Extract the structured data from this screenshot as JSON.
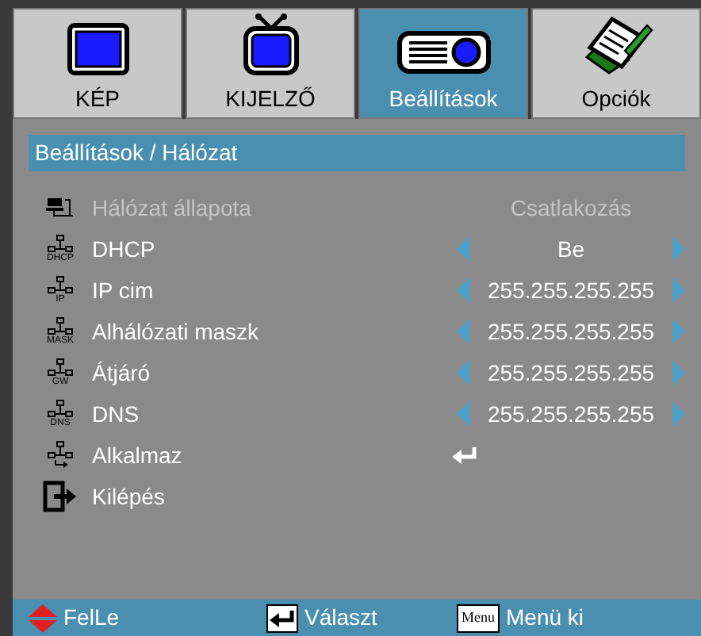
{
  "tabs": [
    {
      "label": "KÉP",
      "selected": false,
      "kind": "monitor"
    },
    {
      "label": "KIJELZŐ",
      "selected": false,
      "kind": "tv"
    },
    {
      "label": "Beállítások",
      "selected": true,
      "kind": "projector"
    },
    {
      "label": "Opciók",
      "selected": false,
      "kind": "notepad"
    }
  ],
  "breadcrumb": "Beállítások / Hálózat",
  "rows": [
    {
      "kind": "status",
      "label": "Hálózat állapota",
      "value": "Csatlakozás",
      "disabled": true
    },
    {
      "kind": "option",
      "icon_label": "DHCP",
      "label": "DHCP",
      "value": "Be",
      "disabled": false
    },
    {
      "kind": "option",
      "icon_label": "IP",
      "label": "IP cim",
      "value": "255.255.255.255",
      "disabled": false
    },
    {
      "kind": "option",
      "icon_label": "MASK",
      "label": "Alhálózati maszk",
      "value": "255.255.255.255",
      "disabled": false
    },
    {
      "kind": "option",
      "icon_label": "GW",
      "label": "Átjáró",
      "value": "255.255.255.255",
      "disabled": false
    },
    {
      "kind": "option",
      "icon_label": "DNS",
      "label": "DNS",
      "value": "255.255.255.255",
      "disabled": false
    },
    {
      "kind": "apply",
      "label": "Alkalmaz",
      "disabled": false
    },
    {
      "kind": "exit",
      "label": "Kilépés",
      "disabled": false
    }
  ],
  "footer": [
    {
      "kind": "updown",
      "label": "FelLe"
    },
    {
      "kind": "enter",
      "label": "Választ"
    },
    {
      "kind": "menu",
      "key": "Menu",
      "label": "Menü ki"
    }
  ]
}
